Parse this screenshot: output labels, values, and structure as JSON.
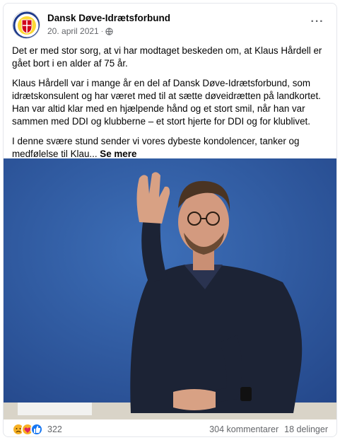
{
  "post": {
    "page_name": "Dansk Døve-Idrætsforbund",
    "date": "20. april 2021",
    "separator": "·",
    "more_label": "···",
    "paragraphs": [
      "Det er med stor sorg, at vi har modtaget beskeden om, at Klaus Hårdell er gået bort i en alder af 75 år.",
      "Klaus Hårdell var i mange år en del af Dansk Døve-Idrætsforbund, som idrætskonsulent og har været med til at sætte døveidrætten på landkortet. Han var altid klar med en hjælpende hånd og et stort smil, når han var sammen med DDI og klubberne – et stort hjerte for DDI og for klublivet.",
      "I denne svære stund sender vi vores dybeste kondolencer, tanker og medfølelse til Klau..."
    ],
    "see_more": "Se mere"
  },
  "footer": {
    "reactions": [
      "sad-icon",
      "care-icon",
      "like-icon"
    ],
    "reaction_count": "322",
    "comments": "304 kommentarer",
    "shares": "18 delinger"
  },
  "colors": {
    "text": "#050505",
    "secondary": "#65676b",
    "like_blue": "#1877f2",
    "reaction_yellow": "#f7b125",
    "logo_red": "#d0021b",
    "logo_navy": "#1e3a8a",
    "backdrop_blue": "#2f5aa0"
  }
}
